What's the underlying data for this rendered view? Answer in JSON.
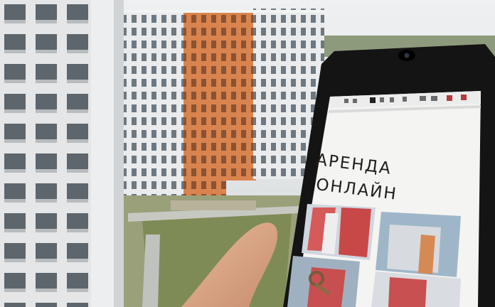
{
  "phone_screen": {
    "headline_line1": "АРЕНДА",
    "headline_line2": "ОНЛАЙН"
  },
  "icons": [
    "smartphone-icon",
    "hand-icon",
    "building-icon",
    "keys-icon"
  ],
  "colors": {
    "sky": "#e8ebee",
    "orange_building": "#d9844e",
    "phone_body": "#141414",
    "screen_bg": "#f4f4f2",
    "grass": "#7f8b56"
  }
}
